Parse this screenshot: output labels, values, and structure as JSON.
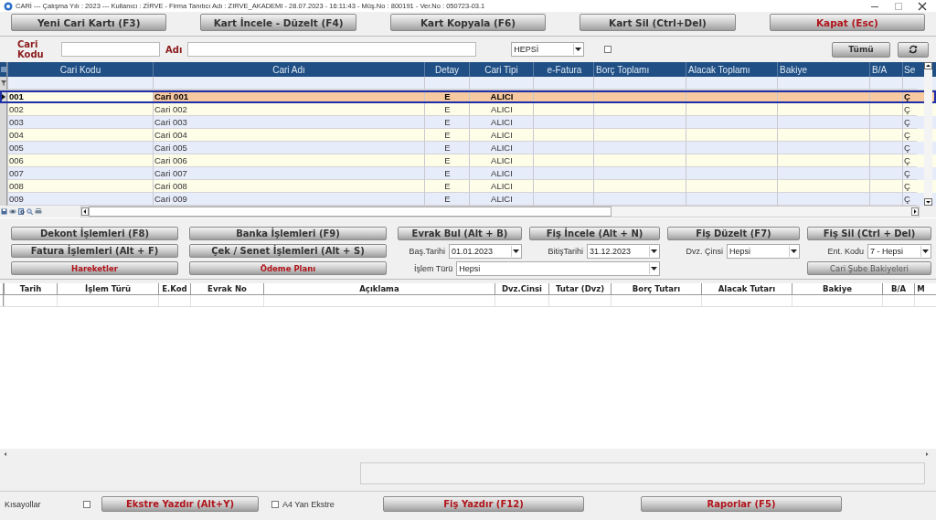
{
  "window": {
    "title": "CARİ  ---  Çalışma Yılı : 2023  ---  Kullanıcı : ZİRVE - Firma Tanıtıcı Adı : ZIRVE_AKADEMI - 28.07.2023 - 16:11:43 - Müş.No : 800191 - Ver.No : 050723-03.1"
  },
  "toolbar": [
    {
      "label": "Yeni Cari Kartı (F3)",
      "accent": false
    },
    {
      "label": "Kart İncele - Düzelt (F4)",
      "accent": false
    },
    {
      "label": "Kart Kopyala (F6)",
      "accent": false
    },
    {
      "label": "Kart Sil (Ctrl+Del)",
      "accent": false
    },
    {
      "label": "Kapat (Esc)",
      "accent": true
    }
  ],
  "filter": {
    "code_label": "Cari Kodu",
    "name_label": "Adı",
    "type_value": "HEPSİ",
    "checkbox": {
      "checked": false
    },
    "all_button": "Tümü"
  },
  "grid": {
    "columns": [
      "Cari Kodu",
      "Cari Adı",
      "Detay",
      "Cari Tipi",
      "e-Fatura",
      "Borç Toplamı",
      "Alacak Toplamı",
      "Bakiye",
      "B/A",
      "Se"
    ],
    "rows": [
      {
        "code": "001",
        "name": "Cari 001",
        "detail": "E",
        "type": "ALICI",
        "column_10": "Ç",
        "selected": true
      },
      {
        "code": "002",
        "name": "Cari 002",
        "detail": "E",
        "type": "ALICI",
        "column_10": "Ç",
        "selected": false
      },
      {
        "code": "003",
        "name": "Cari 003",
        "detail": "E",
        "type": "ALICI",
        "column_10": "Ç",
        "selected": false
      },
      {
        "code": "004",
        "name": "Cari 004",
        "detail": "E",
        "type": "ALICI",
        "column_10": "Ç",
        "selected": false
      },
      {
        "code": "005",
        "name": "Cari 005",
        "detail": "E",
        "type": "ALICI",
        "column_10": "Ç",
        "selected": false
      },
      {
        "code": "006",
        "name": "Cari 006",
        "detail": "E",
        "type": "ALICI",
        "column_10": "Ç",
        "selected": false
      },
      {
        "code": "007",
        "name": "Cari 007",
        "detail": "E",
        "type": "ALICI",
        "column_10": "Ç",
        "selected": false
      },
      {
        "code": "008",
        "name": "Cari 008",
        "detail": "E",
        "type": "ALICI",
        "column_10": "Ç",
        "selected": false
      },
      {
        "code": "009",
        "name": "Cari 009",
        "detail": "E",
        "type": "ALICI",
        "column_10": "Ç",
        "selected": false
      }
    ]
  },
  "left_buttons": [
    {
      "label": "Dekont İşlemleri (F8)",
      "accent": false
    },
    {
      "label": "Banka İşlemleri (F9)",
      "accent": false
    },
    {
      "label": "Fatura İşlemleri (Alt + F)",
      "accent": false
    },
    {
      "label": "Çek / Senet İşlemleri (Alt + S)",
      "accent": false
    },
    {
      "label": "Hareketler",
      "accent": true
    },
    {
      "label": "Ödeme Planı",
      "accent": true
    }
  ],
  "right_buttons": [
    {
      "label": "Evrak Bul (Alt + B)",
      "accent": false
    },
    {
      "label": "Fiş İncele (Alt + N)",
      "accent": false
    },
    {
      "label": "Fiş Düzelt (F7)",
      "accent": false
    },
    {
      "label": "Fiş Sil (Ctrl + Del)",
      "accent": false
    }
  ],
  "selectors": [
    {
      "label": "Baş.Tarihi",
      "value": "01.01.2023"
    },
    {
      "label": "BitişTarihi",
      "value": "31.12.2023"
    },
    {
      "label": "Dvz. Çinsi",
      "value": "Hepsi"
    },
    {
      "label": "Ent. Kodu",
      "value": "7 - Hepsi"
    }
  ],
  "transaction_type": {
    "label": "İşlem Türü",
    "value": "Hepsi"
  },
  "branch_button": {
    "label": "Cari Şube Bakiyeleri",
    "disabled": true
  },
  "movements": {
    "columns": [
      "Tarih",
      "İşlem Türü",
      "E.Kod",
      "Evrak No",
      "Açıklama",
      "Dvz.Cinsi",
      "Tutar (Dvz)",
      "Borç Tutarı",
      "Alacak Tutarı",
      "Bakiye",
      "B/A",
      "M"
    ]
  },
  "bottom": {
    "shortcuts_label": "Kısayollar",
    "shortcuts_checked": false,
    "statement_button": {
      "label": "Ekstre Yazdır (Alt+Y)",
      "accent": true
    },
    "landscape": {
      "label": "A4 Yan Ekstre",
      "checked": false
    },
    "buttons": [
      {
        "label": "Fiş Yazdır (F12)",
        "accent": true
      },
      {
        "label": "Raporlar (F5)",
        "accent": true
      }
    ]
  }
}
